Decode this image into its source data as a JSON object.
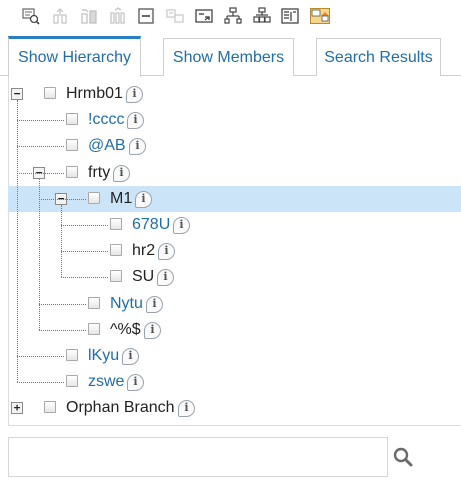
{
  "toolbar": {
    "icons": [
      {
        "name": "zoom-tree-icon",
        "enabled": true
      },
      {
        "name": "move-up-icon",
        "enabled": false
      },
      {
        "name": "move-in-icon",
        "enabled": false
      },
      {
        "name": "move-down-icon",
        "enabled": false
      },
      {
        "name": "collapse-icon",
        "enabled": true
      },
      {
        "name": "expand-disabled-icon",
        "enabled": false
      },
      {
        "name": "expand-window-icon",
        "enabled": true
      },
      {
        "name": "hierarchy-icon",
        "enabled": true
      },
      {
        "name": "org-chart-icon",
        "enabled": true
      },
      {
        "name": "details-list-icon",
        "enabled": true
      },
      {
        "name": "home-highlight-icon",
        "enabled": true
      }
    ]
  },
  "tabs": [
    {
      "label": "Show Hierarchy",
      "active": true
    },
    {
      "label": "Show Members",
      "active": false
    },
    {
      "label": "Search Results",
      "active": false
    }
  ],
  "tree": {
    "info_glyph": "i",
    "nodes": [
      {
        "label": "Hrmb01",
        "depth": 0,
        "toggle": "−",
        "style": "dark",
        "selected": false
      },
      {
        "label": "!cccc",
        "depth": 1,
        "toggle": "",
        "style": "blue",
        "selected": false
      },
      {
        "label": "@AB",
        "depth": 1,
        "toggle": "",
        "style": "blue",
        "selected": false
      },
      {
        "label": "frty",
        "depth": 1,
        "toggle": "−",
        "style": "dark",
        "selected": false
      },
      {
        "label": "M1",
        "depth": 2,
        "toggle": "−",
        "style": "dark",
        "selected": true
      },
      {
        "label": "678U",
        "depth": 3,
        "toggle": "",
        "style": "blue",
        "selected": false
      },
      {
        "label": "hr2",
        "depth": 3,
        "toggle": "",
        "style": "dark",
        "selected": false
      },
      {
        "label": "SU",
        "depth": 3,
        "toggle": "",
        "style": "dark",
        "selected": false
      },
      {
        "label": "Nytu",
        "depth": 2,
        "toggle": "",
        "style": "blue",
        "selected": false
      },
      {
        "label": "^%$",
        "depth": 2,
        "toggle": "",
        "style": "dark",
        "selected": false
      },
      {
        "label": "lKyu",
        "depth": 1,
        "toggle": "",
        "style": "blue",
        "selected": false
      },
      {
        "label": "zswe",
        "depth": 1,
        "toggle": "",
        "style": "blue",
        "selected": false
      },
      {
        "label": "Orphan Branch",
        "depth": 0,
        "toggle": "+",
        "style": "dark",
        "selected": false
      }
    ]
  },
  "search": {
    "value": "",
    "placeholder": "",
    "button_icon": "search-icon"
  }
}
